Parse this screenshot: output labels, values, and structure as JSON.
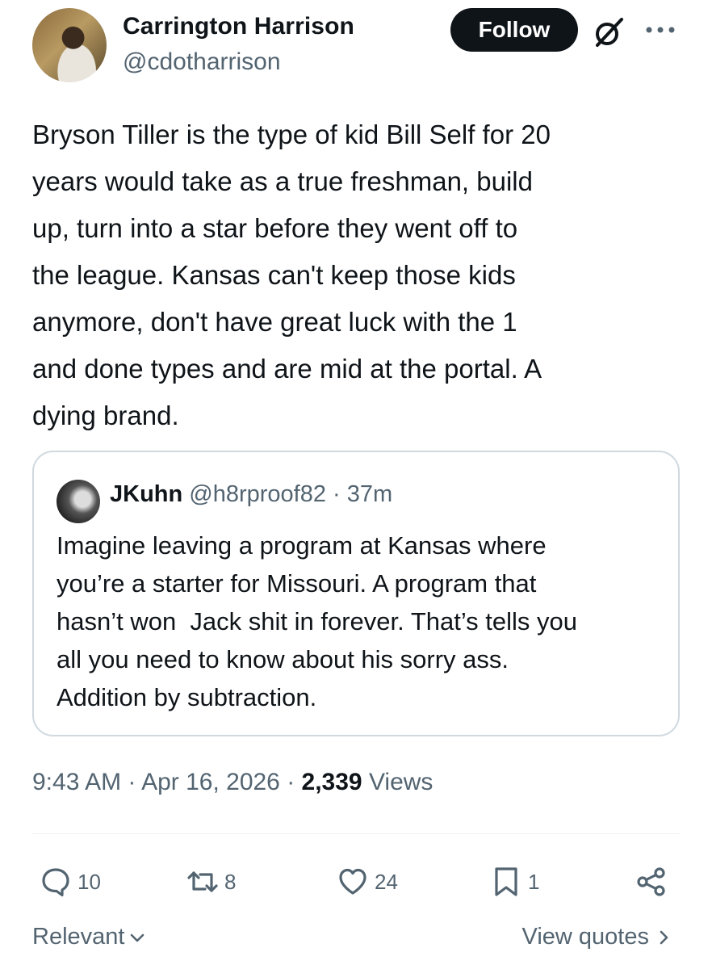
{
  "author": {
    "name": "Carrington Harrison",
    "handle": "@cdotharrison"
  },
  "header": {
    "follow_label": "Follow",
    "icons": [
      "grok-icon",
      "more-icon"
    ]
  },
  "tweet": {
    "text": "Bryson Tiller is the type of kid Bill Self for 20\nyears would take as a true freshman, build\nup, turn into a star before they went off to\nthe league. Kansas can't keep those kids\nanymore, don't have great luck with the 1\nand done types and are mid at the portal. A\ndying brand."
  },
  "quote": {
    "name": "JKuhn",
    "meta": " @h8rproof82 · 37m",
    "text": "Imagine leaving a program at Kansas where\nyou’re a starter for Missouri. A program that\nhasn’t won  Jack shit in forever. That’s tells you\nall you need to know about his sorry ass.\nAddition by subtraction."
  },
  "meta": {
    "time_date": "9:43 AM · Apr 16, 2026 · ",
    "views_count": "2,339",
    "views_label": " Views"
  },
  "actions": {
    "replies": "10",
    "reposts": "8",
    "likes": "24",
    "bookmarks": "1",
    "icons": [
      "reply-icon",
      "repost-icon",
      "like-icon",
      "bookmark-icon",
      "share-icon"
    ]
  },
  "footer": {
    "sort_label": "Relevant",
    "view_quotes_label": "View quotes"
  },
  "colors": {
    "text": "#0f1419",
    "secondary": "#536471",
    "border": "#cfd9de",
    "button_bg": "#0f1419"
  }
}
